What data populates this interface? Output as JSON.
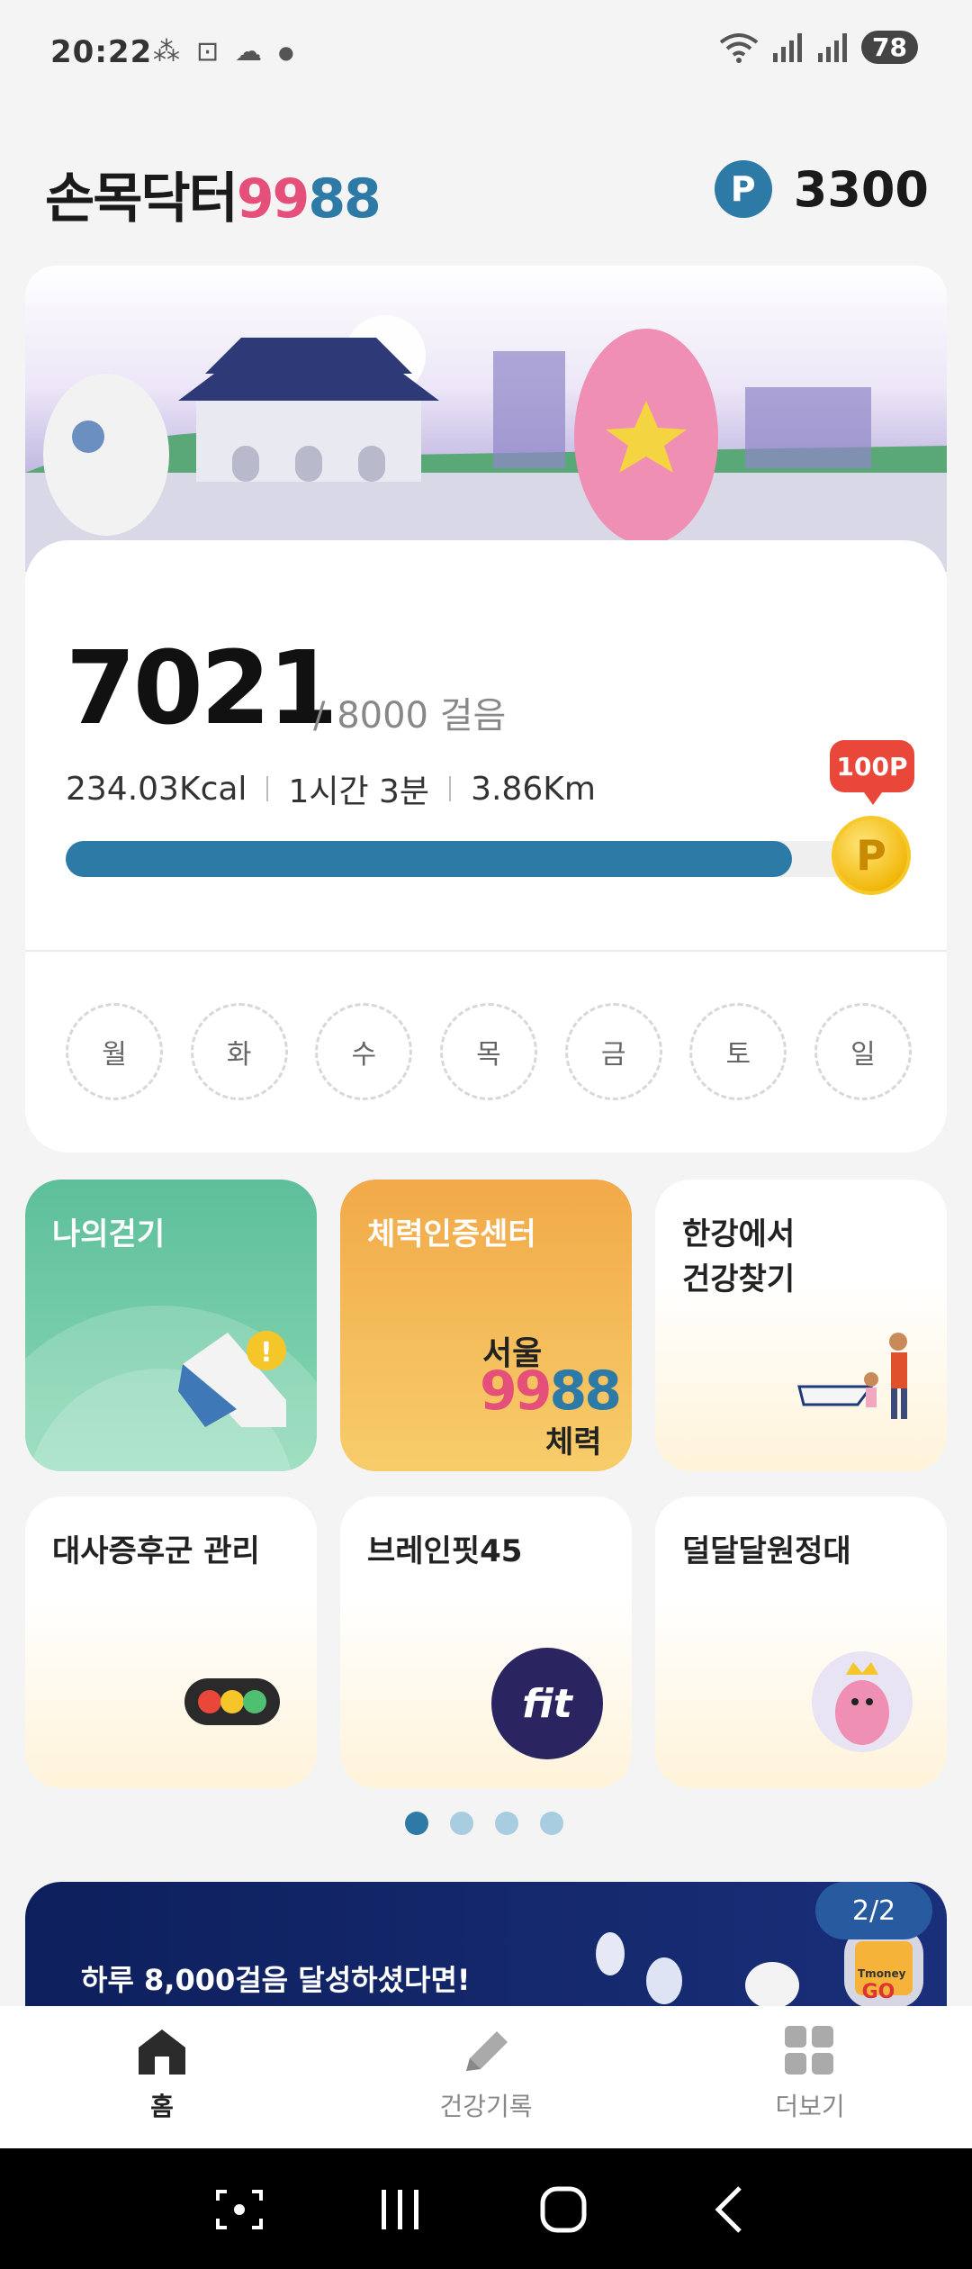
{
  "status_bar": {
    "time": "20:22",
    "battery": "78"
  },
  "header": {
    "logo_text": "손목닥터",
    "logo_num1": "99",
    "logo_num2": "88",
    "point_badge": "P",
    "points": "3300"
  },
  "steps": {
    "count": "7021",
    "goal": "/ 8000 걸음",
    "kcal": "234.03Kcal",
    "duration": "1시간 3분",
    "distance": "3.86Km",
    "progress_fraction": 0.8776,
    "reward_label": "100P",
    "coin_label": "P",
    "weekdays": [
      "월",
      "화",
      "수",
      "목",
      "금",
      "토",
      "일"
    ]
  },
  "tiles": [
    {
      "label": "나의걷기"
    },
    {
      "label": "체력인증센터",
      "logo_top": "서울",
      "logo_num1": "99",
      "logo_num2": "88",
      "logo_bottom": "체력"
    },
    {
      "label_line1": "한강에서",
      "label_line2": "건강찾기"
    },
    {
      "label": "대사증후군 관리"
    },
    {
      "label": "브레인핏45",
      "logo": "fit"
    },
    {
      "label": "덜달달원정대"
    }
  ],
  "pager": {
    "count": 4,
    "active": 0
  },
  "ad": {
    "text": "하루 8,000걸음 달성하셨다면!",
    "counter": "2/2",
    "badge_top": "Tmoney",
    "badge_bottom": "GO"
  },
  "bottom_nav": [
    {
      "label": "홈",
      "icon": "home-icon",
      "active": true
    },
    {
      "label": "건강기록",
      "icon": "pencil-icon",
      "active": false
    },
    {
      "label": "더보기",
      "icon": "grid-icon",
      "active": false
    }
  ],
  "colors": {
    "accent": "#2e7aa6",
    "pink": "#e4507a",
    "reward_red": "#e8473a",
    "coin_gold": "#f2b90d"
  }
}
